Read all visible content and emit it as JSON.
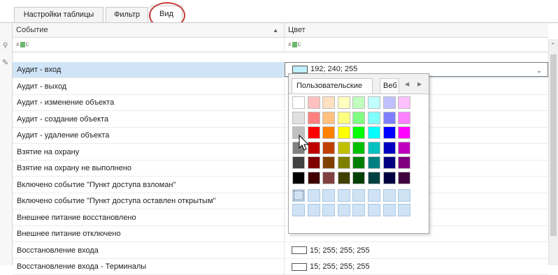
{
  "tabs": [
    {
      "label": "Настройки таблицы"
    },
    {
      "label": "Фильтр"
    },
    {
      "label": "Вид",
      "active": true
    }
  ],
  "grid": {
    "columns": [
      {
        "label": "Событие",
        "sorted": "asc"
      },
      {
        "label": "Цвет"
      }
    ],
    "filter_icon_text": "ABC",
    "rows": [
      {
        "event": "Аудит - вход",
        "color": "192; 240; 255",
        "swatch": "#c0f0ff",
        "selected": true
      },
      {
        "event": "Аудит - выход",
        "color": ""
      },
      {
        "event": "Аудит - изменение объекта",
        "color": ""
      },
      {
        "event": "Аудит - создание объекта",
        "color": ""
      },
      {
        "event": "Аудит - удаление объекта",
        "color": ""
      },
      {
        "event": "Взятие на охрану",
        "color": ""
      },
      {
        "event": "Взятие на охрану не выполнено",
        "color": ""
      },
      {
        "event": "Включено событие \"Пункт доступа взломан\"",
        "color": ""
      },
      {
        "event": "Включено событие \"Пункт доступа оставлен открытым\"",
        "color": ""
      },
      {
        "event": "Внешнее питание восстановлено",
        "color": ""
      },
      {
        "event": "Внешнее питание отключено",
        "color": ""
      },
      {
        "event": "Восстановление входа",
        "color": "15; 255; 255; 255",
        "swatch": "#ffffff"
      },
      {
        "event": "Восстановление входа - Терминалы",
        "color": "15; 255; 255; 255",
        "swatch": "#ffffff"
      }
    ]
  },
  "color_popup": {
    "tabs": [
      "Пользовательские",
      "Веб"
    ],
    "palette_rows": [
      [
        "#ffffff",
        "#ffc0c0",
        "#ffe0c0",
        "#ffffc0",
        "#c0ffc0",
        "#c0ffff",
        "#c0c0ff",
        "#ffc0ff"
      ],
      [
        "#e0e0e0",
        "#ff8080",
        "#ffc080",
        "#ffff80",
        "#80ff80",
        "#80ffff",
        "#8080ff",
        "#ff80ff"
      ],
      [
        "#c0c0c0",
        "#ff0000",
        "#ff8000",
        "#ffff00",
        "#00ff00",
        "#00ffff",
        "#0000ff",
        "#ff00ff"
      ],
      [
        "#808080",
        "#c00000",
        "#c04000",
        "#c0c000",
        "#00c000",
        "#00c0c0",
        "#0000c0",
        "#c000c0"
      ],
      [
        "#404040",
        "#800000",
        "#804000",
        "#808000",
        "#008000",
        "#008080",
        "#000080",
        "#800080"
      ],
      [
        "#000000",
        "#400000",
        "#804040",
        "#404000",
        "#004000",
        "#004040",
        "#000040",
        "#400040"
      ]
    ],
    "custom_rows": 2
  },
  "colors": {
    "selection": "#cfe4f7",
    "highlight_circle": "#c83c3c"
  }
}
